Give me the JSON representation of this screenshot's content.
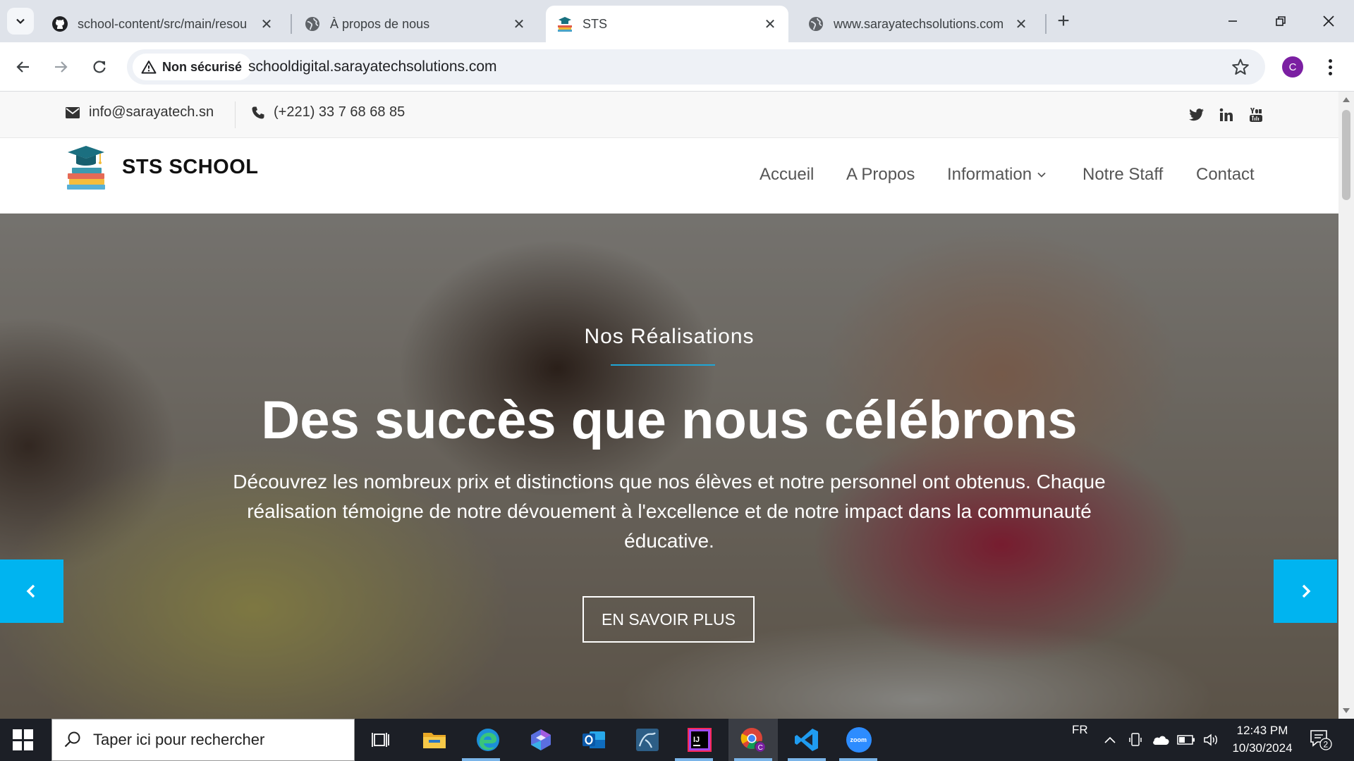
{
  "browser": {
    "tabs": [
      {
        "title": "school-content/src/main/resou",
        "favicon": "github-icon",
        "active": false
      },
      {
        "title": "À propos de nous",
        "favicon": "globe-icon",
        "active": false
      },
      {
        "title": "STS",
        "favicon": "school-books-icon",
        "active": true
      },
      {
        "title": "www.sarayatechsolutions.com",
        "favicon": "globe-icon",
        "active": false
      }
    ],
    "new_tab_label": "+",
    "security_label": "Non sécurisé",
    "url": "schooldigital.sarayatechsolutions.com",
    "profile_initial": "C"
  },
  "site": {
    "topbar": {
      "email": "info@sarayatech.sn",
      "phone": "(+221) 33 7 68 68 85",
      "social": [
        "twitter-icon",
        "linkedin-icon",
        "youtube-icon"
      ]
    },
    "logo_text": "STS SCHOOL",
    "nav": [
      {
        "label": "Accueil"
      },
      {
        "label": "A Propos"
      },
      {
        "label": "Information",
        "has_dropdown": true
      },
      {
        "label": "Notre Staff"
      },
      {
        "label": "Contact"
      }
    ],
    "hero": {
      "subtitle": "Nos Réalisations",
      "headline": "Des succès que nous célébrons",
      "description": "Découvrez les nombreux prix et distinctions que nos élèves et notre personnel ont obtenus. Chaque réalisation témoigne de notre dévouement à l'excellence et de notre impact dans la communauté éducative.",
      "cta": "EN SAVOIR PLUS"
    },
    "colors": {
      "accent": "#00b4f0",
      "underline": "#1fa6d6"
    }
  },
  "taskbar": {
    "search_placeholder": "Taper ici pour rechercher",
    "language": "FR",
    "time": "12:43 PM",
    "date": "10/30/2024",
    "notification_count": "2",
    "apps": [
      "task-view-icon",
      "file-explorer-icon",
      "edge-icon",
      "copilot-icon",
      "outlook-icon",
      "mysql-workbench-icon",
      "intellij-icon",
      "chrome-icon",
      "vscode-icon",
      "zoom-icon"
    ],
    "zoom_label": "zoom",
    "intellij_label": "IJ"
  }
}
